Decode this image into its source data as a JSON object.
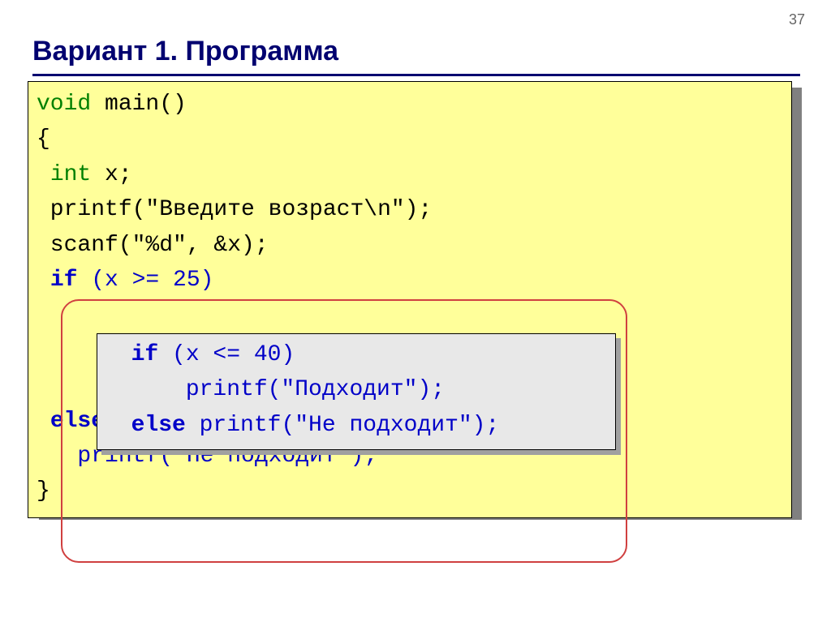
{
  "page_number": "37",
  "title": "Вариант 1. Программа",
  "code": {
    "l1a": "void",
    "l1b": " main()",
    "l2": "{",
    "l3a": " ",
    "l3b": "int",
    "l3c": " x;",
    "l4": " printf(\"Введите возраст\\n\");",
    "l5": " scanf(\"%d\", &x);",
    "l6a": " ",
    "l6b": "if",
    "l6c": " (x >= 25)",
    "l10a": " ",
    "l10b": "else",
    "l11": "   printf(\"Не подходит\");",
    "l12": "}"
  },
  "inner": {
    "i1a": "  ",
    "i1b": "if",
    "i1c": " (x <= 40)",
    "i2": "      printf(\"Подходит\");",
    "i3a": "  ",
    "i3b": "else",
    "i3c": " printf(\"Не подходит\");"
  }
}
